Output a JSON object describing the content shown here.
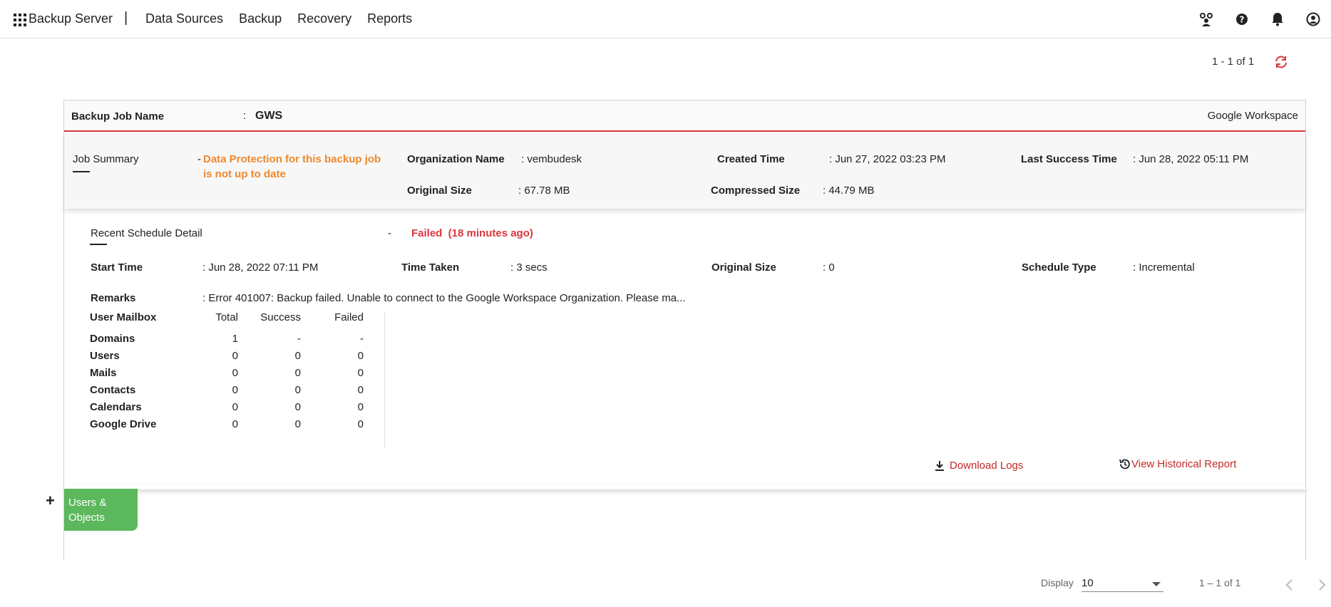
{
  "topbar": {
    "brand": "Backup Server",
    "separator": "|",
    "nav": [
      "Data Sources",
      "Backup",
      "Recovery",
      "Reports"
    ],
    "icons": [
      "users-icon",
      "help-icon",
      "bell-icon",
      "account-icon"
    ]
  },
  "pager_top": {
    "text": "1 - 1 of 1",
    "icon": "refresh-icon"
  },
  "job": {
    "name_label": "Backup Job Name",
    "colon": ":",
    "name": "GWS",
    "type": "Google Workspace"
  },
  "summary": {
    "label": "Job Summary",
    "dash": "-",
    "warning_line1": "Data Protection for this backup job",
    "warning_line2": "is not up to date",
    "org_label": "Organization Name",
    "org_value": ": vembudesk",
    "created_label": "Created Time",
    "created_value": ": Jun 27, 2022 03:23 PM",
    "last_success_label": "Last Success Time",
    "last_success_value": ": Jun 28, 2022 05:11 PM",
    "orig_size_label": "Original Size",
    "orig_size_value": ": 67.78 MB",
    "comp_size_label": "Compressed Size",
    "comp_size_value": ": 44.79 MB"
  },
  "recent": {
    "label": "Recent Schedule Detail",
    "dash": "-",
    "status": "Failed  (18 minutes ago)",
    "start_label": "Start Time",
    "start_value": ": Jun 28, 2022 07:11 PM",
    "taken_label": "Time Taken",
    "taken_value": ": 3 secs",
    "orig_label": "Original Size",
    "orig_value": ": 0",
    "sched_label": "Schedule Type",
    "sched_value": ": Incremental",
    "remarks_label": "Remarks",
    "remarks_value": ": Error 401007: Backup failed. Unable to connect to the Google Workspace Organization. Please ma..."
  },
  "mailbox": {
    "headers": [
      "User Mailbox",
      "Total",
      "Success",
      "Failed"
    ],
    "rows": [
      [
        "Domains",
        "1",
        "-",
        "-"
      ],
      [
        "Users",
        "0",
        "0",
        "0"
      ],
      [
        "Mails",
        "0",
        "0",
        "0"
      ],
      [
        "Contacts",
        "0",
        "0",
        "0"
      ],
      [
        "Calendars",
        "0",
        "0",
        "0"
      ],
      [
        "Google Drive",
        "0",
        "0",
        "0"
      ]
    ]
  },
  "links": {
    "download": "Download Logs",
    "history": "View Historical Report"
  },
  "users_tab": {
    "line1": "Users &",
    "line2": "Objects",
    "plus": "+"
  },
  "footer": {
    "display_label": "Display",
    "display_value": "10",
    "range": "1 – 1 of 1"
  },
  "colors": {
    "accent_red": "#d9363e",
    "warning": "#f0882b",
    "tab_green": "#5cb85c"
  }
}
